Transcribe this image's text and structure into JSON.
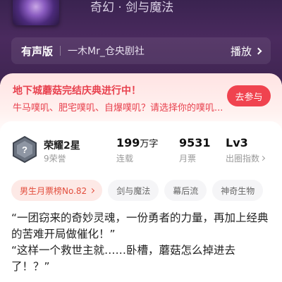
{
  "hero": {
    "genre_line": "奇幻 · 剑与魔法"
  },
  "audio": {
    "tag": "有声版",
    "producer": "一木Mr_仓央剧社",
    "play_label": "播放"
  },
  "event": {
    "title": "地下城蘑菇完结庆典进行中！",
    "subtitle": "牛马噗叽、肥宅噗叽、自爆噗叽？请选择你的噗叽...",
    "join_label": "去参与"
  },
  "stats": {
    "honor_title": "荣耀2星",
    "honor_sub": "9荣誉",
    "words_value": "199",
    "words_unit": "万字",
    "words_label": "连载",
    "tickets_value": "9531",
    "tickets_label": "月票",
    "level_value": "Lv3",
    "level_label": "出圈指数"
  },
  "tags": {
    "rank": "男生月票榜No.82",
    "items": [
      "剑与魔法",
      "幕后流",
      "神奇生物"
    ]
  },
  "quote": {
    "line1": "“一团窃来的奇妙灵魂，一份勇者的力量，再加上经典的苦难开局做催化！”",
    "line2": "“这样一个救世主就……卧槽，蘑菇怎么掉进去了！？”"
  },
  "colors": {
    "accent_red": "#f0434f",
    "hero_purple": "#3a2350"
  }
}
